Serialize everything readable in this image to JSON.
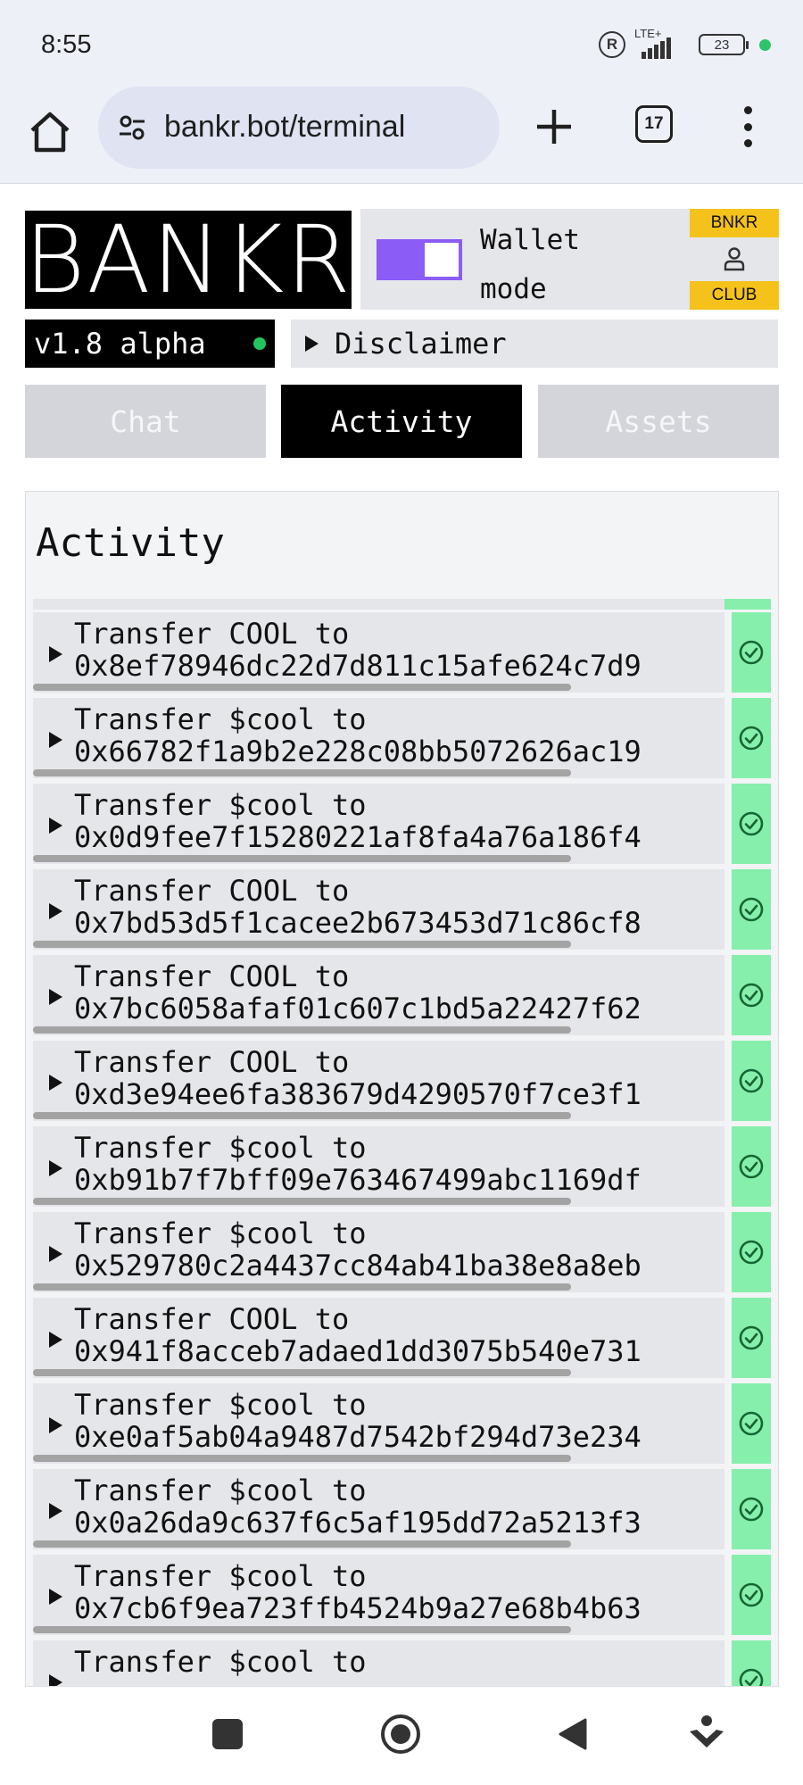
{
  "status_bar": {
    "time": "8:55",
    "registered_mark": "R",
    "network": "LTE+",
    "battery": "23",
    "dot_color": "#2ec46a"
  },
  "browser": {
    "url": "bankr.bot/terminal",
    "tab_count": "17",
    "icons": [
      "home-icon",
      "site-settings-icon",
      "new-tab-plus-icon",
      "tab-switcher-icon",
      "more-menu-icon"
    ]
  },
  "header": {
    "logo": "BANKR",
    "wallet_mode_line1": "Wallet",
    "wallet_mode_line2": "mode",
    "toggle_on": true,
    "toggle_color": "#8b5cf6",
    "club_top": "BNKR",
    "club_bottom": "CLUB",
    "version": "v1.8 alpha",
    "disclaimer": "Disclaimer"
  },
  "tabs": {
    "chat": "Chat",
    "activity": "Activity",
    "assets": "Assets",
    "active": "activity"
  },
  "activity": {
    "title": "Activity",
    "status_color": "#86efac",
    "items": [
      {
        "line1": "Transfer COOL to",
        "line2": "0x8ef78946dc22d7d811c15afe624c7d9",
        "status": "success"
      },
      {
        "line1": "Transfer $cool to",
        "line2": "0x66782f1a9b2e228c08bb5072626ac19",
        "status": "success"
      },
      {
        "line1": "Transfer $cool to",
        "line2": "0x0d9fee7f15280221af8fa4a76a186f4",
        "status": "success"
      },
      {
        "line1": "Transfer COOL to",
        "line2": "0x7bd53d5f1cacee2b673453d71c86cf8",
        "status": "success"
      },
      {
        "line1": "Transfer COOL to",
        "line2": "0x7bc6058afaf01c607c1bd5a22427f62",
        "status": "success"
      },
      {
        "line1": "Transfer COOL to",
        "line2": "0xd3e94ee6fa383679d4290570f7ce3f1",
        "status": "success"
      },
      {
        "line1": "Transfer $cool to",
        "line2": "0xb91b7f7bff09e763467499abc1169df",
        "status": "success"
      },
      {
        "line1": "Transfer $cool to",
        "line2": "0x529780c2a4437cc84ab41ba38e8a8eb",
        "status": "success"
      },
      {
        "line1": "Transfer COOL to",
        "line2": "0x941f8acceb7adaed1dd3075b540e731",
        "status": "success"
      },
      {
        "line1": "Transfer $cool to",
        "line2": "0xe0af5ab04a9487d7542bf294d73e234",
        "status": "success"
      },
      {
        "line1": "Transfer $cool to",
        "line2": "0x0a26da9c637f6c5af195dd72a5213f3",
        "status": "success"
      },
      {
        "line1": "Transfer $cool to",
        "line2": "0x7cb6f9ea723ffb4524b9a27e68b4b63",
        "status": "success"
      },
      {
        "line1": "Transfer $cool to",
        "line2": "",
        "status": "success"
      }
    ]
  },
  "nav_bar": {
    "icons": [
      "recents-square-icon",
      "home-circle-icon",
      "back-triangle-icon",
      "assistant-icon"
    ]
  }
}
